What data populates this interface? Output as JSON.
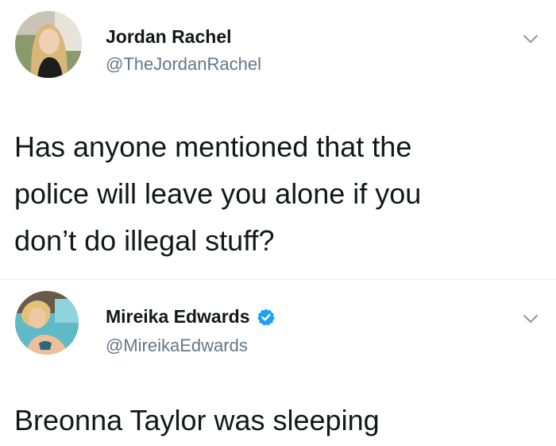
{
  "tweets": [
    {
      "author": {
        "display_name": "Jordan Rachel",
        "handle": "@TheJordanRachel",
        "verified": false
      },
      "text_lines": [
        "Has anyone mentioned that the",
        "police will leave you alone if you",
        "don’t do illegal stuff?"
      ],
      "menu_icon": "chevron-down-icon"
    },
    {
      "author": {
        "display_name": "Mireika Edwards",
        "handle": "@MireikaEdwards",
        "verified": true
      },
      "text_lines": [
        "Breonna Taylor was sleeping"
      ],
      "menu_icon": "chevron-down-icon"
    }
  ],
  "colors": {
    "name": "#14171a",
    "handle": "#657786",
    "verified": "#1da1f2",
    "divider": "#e6ecf0",
    "chevron": "#8899a6"
  }
}
